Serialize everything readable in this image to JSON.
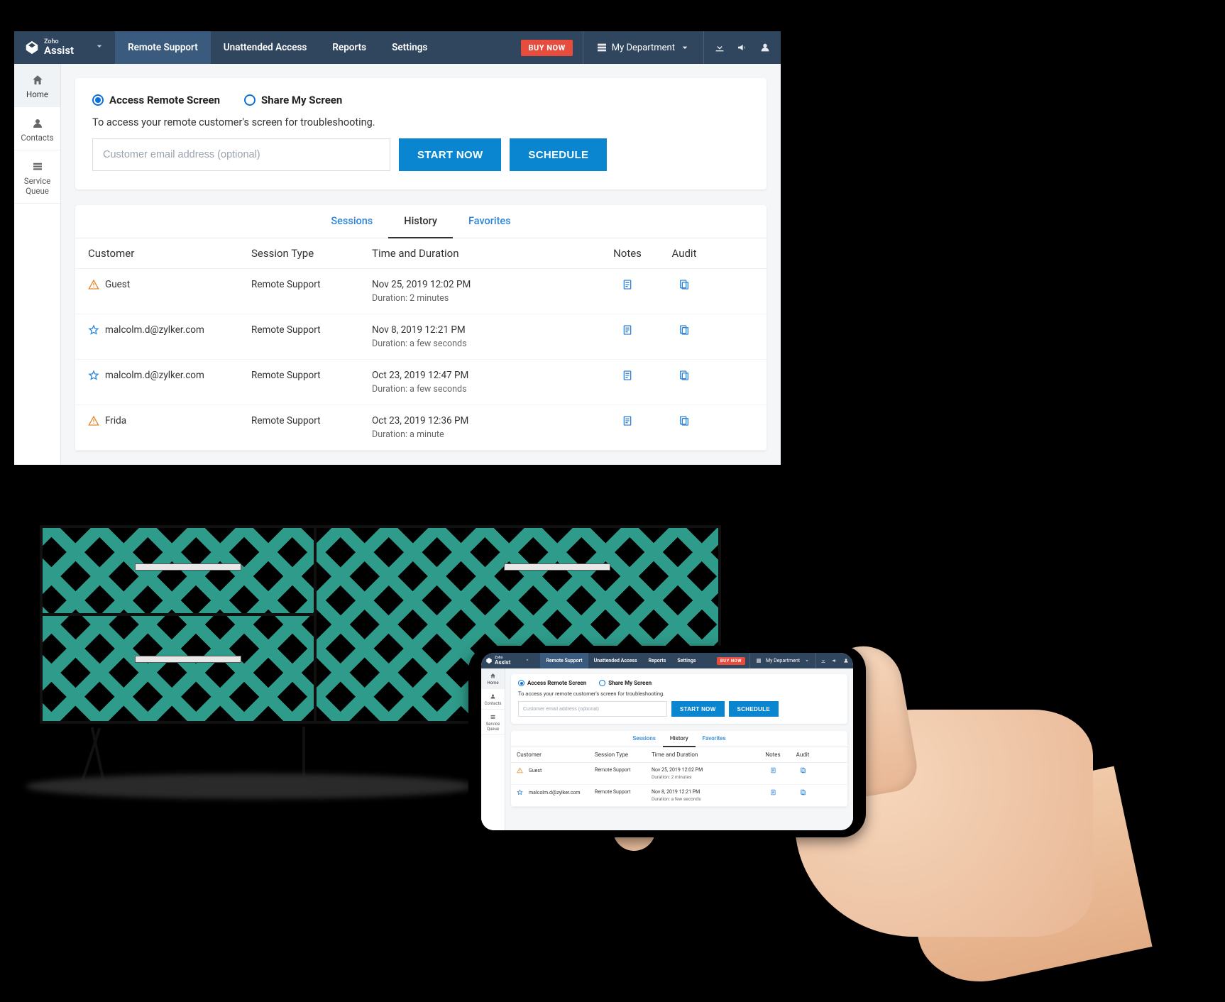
{
  "brand": {
    "top": "Zoho",
    "bottom": "Assist"
  },
  "nav": {
    "remote_support": "Remote Support",
    "unattended": "Unattended Access",
    "reports": "Reports",
    "settings": "Settings",
    "buy_now": "BUY NOW",
    "department": "My Department"
  },
  "sidebar": {
    "home": "Home",
    "contacts": "Contacts",
    "service_queue": "Service\nQueue"
  },
  "panel": {
    "mode_access": "Access Remote Screen",
    "mode_share": "Share My Screen",
    "subtext": "To access your remote customer's screen for troubleshooting.",
    "email_placeholder": "Customer email address (optional)",
    "start": "START NOW",
    "schedule": "SCHEDULE"
  },
  "tabs": {
    "sessions": "Sessions",
    "history": "History",
    "favorites": "Favorites"
  },
  "columns": {
    "customer": "Customer",
    "session_type": "Session Type",
    "time": "Time and Duration",
    "notes": "Notes",
    "audit": "Audit"
  },
  "rows": [
    {
      "icon": "warning",
      "customer": "Guest",
      "type": "Remote Support",
      "time": "Nov 25, 2019 12:02 PM",
      "duration": "Duration: 2 minutes"
    },
    {
      "icon": "star",
      "customer": "malcolm.d@zylker.com",
      "type": "Remote Support",
      "time": "Nov 8, 2019 12:21 PM",
      "duration": "Duration: a few seconds"
    },
    {
      "icon": "star",
      "customer": "malcolm.d@zylker.com",
      "type": "Remote Support",
      "time": "Oct 23, 2019 12:47 PM",
      "duration": "Duration: a few seconds"
    },
    {
      "icon": "warning",
      "customer": "Frida",
      "type": "Remote Support",
      "time": "Oct 23, 2019 12:36 PM",
      "duration": "Duration: a minute"
    }
  ],
  "phone_rows": [
    {
      "icon": "warning",
      "customer": "Guest",
      "type": "Remote Support",
      "time": "Nov 25, 2019 12:02 PM",
      "duration": "Duration: 2 minutes"
    },
    {
      "icon": "star",
      "customer": "malcolm.d@zylker.com",
      "type": "Remote Support",
      "time": "Nov 8, 2019 12:21 PM",
      "duration": "Duration: a few seconds"
    }
  ]
}
